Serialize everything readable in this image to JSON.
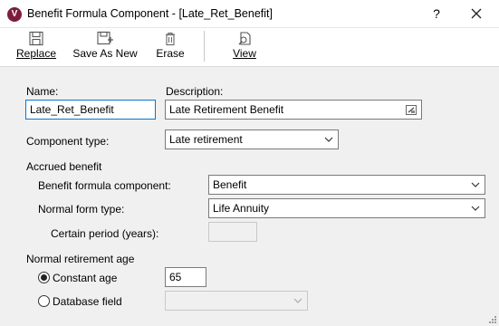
{
  "window": {
    "title": "Benefit Formula Component - [Late_Ret_Benefit]",
    "app_icon_letter": "V",
    "help_label": "?"
  },
  "toolbar": {
    "replace_label": "Replace",
    "save_as_new_label": "Save As New",
    "erase_label": "Erase",
    "view_label": "View"
  },
  "form": {
    "name_label": "Name:",
    "name_value": "Late_Ret_Benefit",
    "description_label": "Description:",
    "description_value": "Late Retirement Benefit",
    "component_type_label": "Component type:",
    "component_type_value": "Late retirement",
    "accrued_benefit_heading": "Accrued benefit",
    "benefit_formula_component_label": "Benefit formula component:",
    "benefit_formula_component_value": "Benefit",
    "normal_form_type_label": "Normal form type:",
    "normal_form_type_value": "Life Annuity",
    "certain_period_label": "Certain period (years):",
    "certain_period_value": "",
    "normal_retirement_age_heading": "Normal retirement age",
    "constant_age_label": "Constant age",
    "constant_age_value": "65",
    "constant_age_checked": true,
    "database_field_label": "Database field",
    "database_field_checked": false,
    "database_field_value": ""
  },
  "icons": {
    "app": "app-logo-icon",
    "help": "help-icon",
    "close": "close-icon",
    "replace": "save-icon",
    "save_as_new": "save-new-icon",
    "erase": "trash-icon",
    "view": "view-icon",
    "description_edit": "edit-description-icon",
    "dropdown": "chevron-down-icon"
  },
  "colors": {
    "app_icon": "#7b1e3a",
    "focus_border": "#0078d7",
    "window_bg": "#f0f0f0"
  }
}
